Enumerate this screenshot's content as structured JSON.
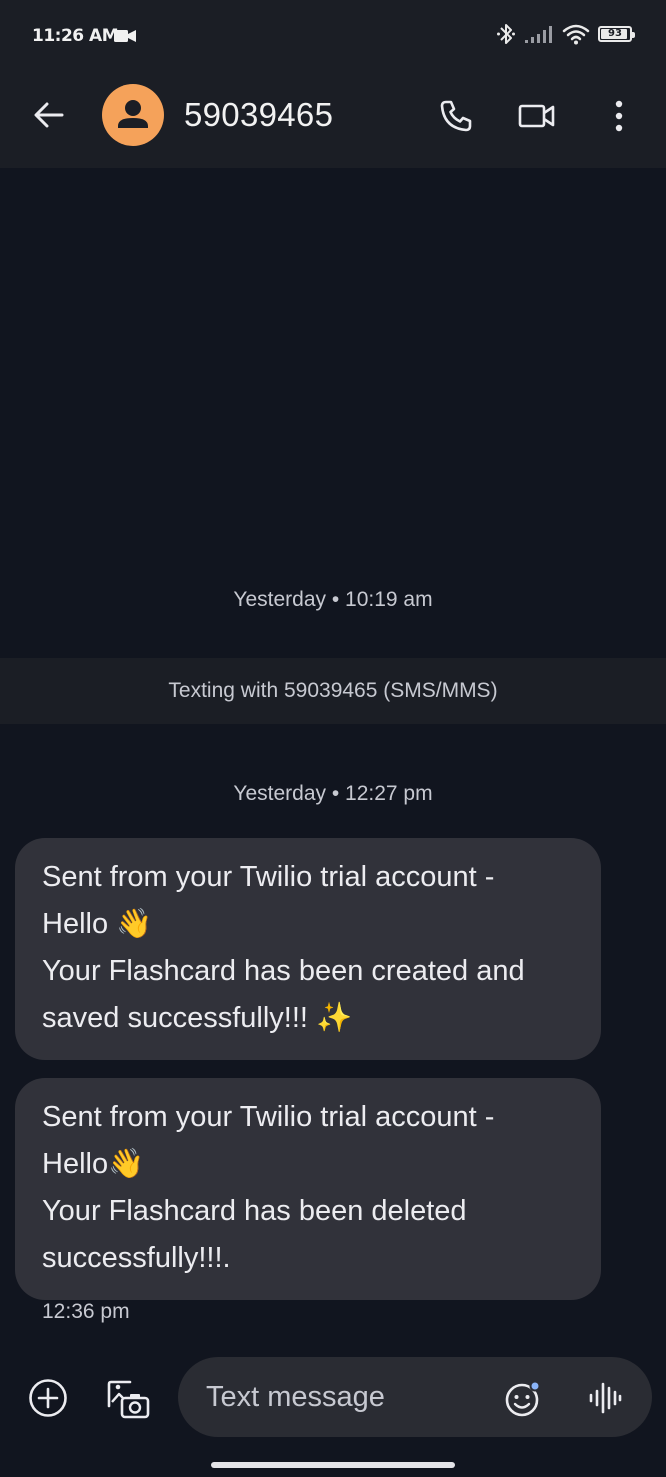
{
  "status_bar": {
    "time": "11:26",
    "ampm": "AM",
    "battery": "93"
  },
  "header": {
    "contact": "59039465"
  },
  "conversation": {
    "timestamp_1": "Yesterday • 10:19 am",
    "banner": "Texting with 59039465 (SMS/MMS)",
    "timestamp_2": "Yesterday • 12:27 pm",
    "messages": [
      {
        "lines": [
          "Sent from your Twilio trial account -",
          "Hello 👋",
          "Your Flashcard has been created and",
          "saved successfully!!! ✨"
        ]
      },
      {
        "lines": [
          "Sent from your Twilio trial account -",
          "Hello👋",
          "Your Flashcard has been deleted",
          "successfully!!!."
        ],
        "time": "12:36 pm"
      }
    ]
  },
  "composer": {
    "placeholder": "Text message"
  },
  "colors": {
    "background": "#11151f",
    "bar": "#1b1e25",
    "bubble": "#31323a",
    "avatar": "#f5a25a"
  },
  "icons": [
    "video-recording-icon",
    "bluetooth-icon",
    "signal-icon",
    "wifi-icon",
    "battery-icon",
    "back-arrow-icon",
    "person-icon",
    "phone-icon",
    "video-call-icon",
    "more-vert-icon",
    "add-icon",
    "gallery-icon",
    "emoji-icon",
    "voice-icon"
  ]
}
